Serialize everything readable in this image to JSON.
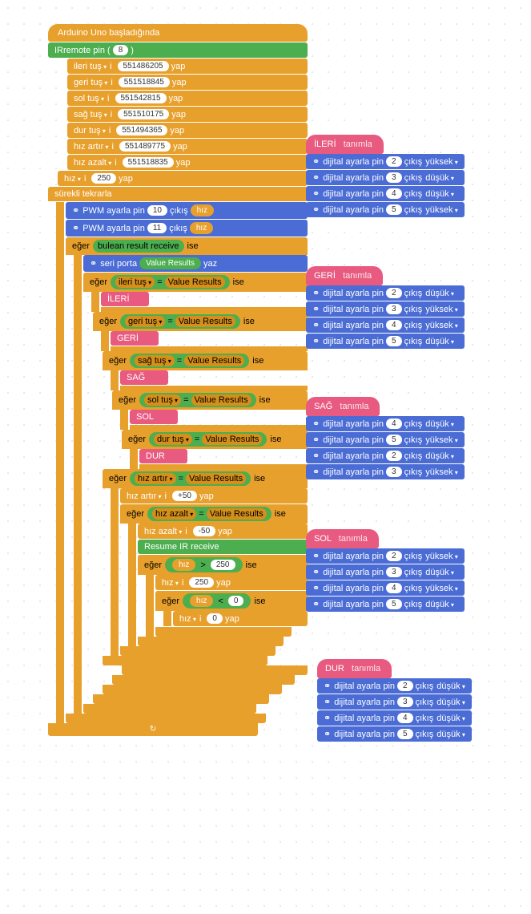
{
  "event": {
    "label": "Arduino Uno başladığında"
  },
  "irremote": {
    "label": "IRremote pin (",
    "pin": "8",
    "close": ")"
  },
  "setvars": [
    {
      "name": "ileri tuş",
      "i": "i",
      "val": "551486205",
      "yap": "yap"
    },
    {
      "name": "geri tuş",
      "i": "i",
      "val": "551518845",
      "yap": "yap"
    },
    {
      "name": "sol tuş",
      "i": "i",
      "val": "551542815",
      "yap": "yap"
    },
    {
      "name": "sağ tuş",
      "i": "i",
      "val": "551510175",
      "yap": "yap"
    },
    {
      "name": "dur tuş",
      "i": "i",
      "val": "551494365",
      "yap": "yap"
    },
    {
      "name": "hız artır",
      "i": "i",
      "val": "551489775",
      "yap": "yap"
    },
    {
      "name": "hız azalt",
      "i": "i",
      "val": "551518835",
      "yap": "yap"
    },
    {
      "name": "hız",
      "i": "i",
      "val": "250",
      "yap": "yap"
    }
  ],
  "forever": "sürekli tekrarla",
  "pwm": [
    {
      "label": "PWM ayarla pin",
      "pin": "10",
      "out": "çıkış",
      "var": "hız"
    },
    {
      "label": "PWM ayarla pin",
      "pin": "11",
      "out": "çıkış",
      "var": "hız"
    }
  ],
  "if_label": "eğer",
  "ise_label": "ise",
  "bulean": "bulean result receive",
  "serial": {
    "label": "seri porta",
    "var": "Value Results",
    "yaz": "yaz"
  },
  "checks": [
    {
      "var": "ileri tuş",
      "eq": "=",
      "vr": "Value Results",
      "call": "İLERİ"
    },
    {
      "var": "geri tuş",
      "eq": "=",
      "vr": "Value Results",
      "call": "GERİ"
    },
    {
      "var": "sağ tuş",
      "eq": "=",
      "vr": "Value Results",
      "call": "SAĞ"
    },
    {
      "var": "sol tuş",
      "eq": "=",
      "vr": "Value Results",
      "call": "SOL"
    },
    {
      "var": "dur tuş",
      "eq": "=",
      "vr": "Value Results",
      "call": "DUR"
    }
  ],
  "hizartir": {
    "var": "hız artır",
    "eq": "=",
    "vr": "Value Results",
    "set": "hız artır",
    "i": "i",
    "val": "+50",
    "yap": "yap"
  },
  "hizazalt": {
    "var": "hız azalt",
    "eq": "=",
    "vr": "Value Results",
    "set": "hız azalt",
    "i": "i",
    "val": "-50",
    "yap": "yap"
  },
  "resume": "Resume IR receive",
  "limit_hi": {
    "var": "hız",
    "op": ">",
    "val": "250",
    "set": "hız",
    "i": "i",
    "sval": "250",
    "yap": "yap"
  },
  "limit_lo": {
    "var": "hız",
    "op": "<",
    "val": "0",
    "set": "hız",
    "i": "i",
    "sval": "0",
    "yap": "yap"
  },
  "defs": {
    "tanimla": "tanımla",
    "ILERI": {
      "name": "İLERİ",
      "pins": [
        {
          "lbl": "dijital ayarla pin",
          "pin": "2",
          "out": "çıkış",
          "lvl": "yüksek"
        },
        {
          "lbl": "dijital ayarla pin",
          "pin": "3",
          "out": "çıkış",
          "lvl": "düşük"
        },
        {
          "lbl": "dijital ayarla pin",
          "pin": "4",
          "out": "çıkış",
          "lvl": "düşük"
        },
        {
          "lbl": "dijital ayarla pin",
          "pin": "5",
          "out": "çıkış",
          "lvl": "yüksek"
        }
      ]
    },
    "GERI": {
      "name": "GERİ",
      "pins": [
        {
          "lbl": "dijital ayarla pin",
          "pin": "2",
          "out": "çıkış",
          "lvl": "düşük"
        },
        {
          "lbl": "dijital ayarla pin",
          "pin": "3",
          "out": "çıkış",
          "lvl": "yüksek"
        },
        {
          "lbl": "dijital ayarla pin",
          "pin": "4",
          "out": "çıkış",
          "lvl": "yüksek"
        },
        {
          "lbl": "dijital ayarla pin",
          "pin": "5",
          "out": "çıkış",
          "lvl": "düşük"
        }
      ]
    },
    "SAG": {
      "name": "SAĞ",
      "pins": [
        {
          "lbl": "dijital ayarla pin",
          "pin": "4",
          "out": "çıkış",
          "lvl": "düşük"
        },
        {
          "lbl": "dijital ayarla pin",
          "pin": "5",
          "out": "çıkış",
          "lvl": "yüksek"
        },
        {
          "lbl": "dijital ayarla pin",
          "pin": "2",
          "out": "çıkış",
          "lvl": "düşük"
        },
        {
          "lbl": "dijital ayarla pin",
          "pin": "3",
          "out": "çıkış",
          "lvl": "yüksek"
        }
      ]
    },
    "SOL": {
      "name": "SOL",
      "pins": [
        {
          "lbl": "dijital ayarla pin",
          "pin": "2",
          "out": "çıkış",
          "lvl": "yüksek"
        },
        {
          "lbl": "dijital ayarla pin",
          "pin": "3",
          "out": "çıkış",
          "lvl": "düşük"
        },
        {
          "lbl": "dijital ayarla pin",
          "pin": "4",
          "out": "çıkış",
          "lvl": "yüksek"
        },
        {
          "lbl": "dijital ayarla pin",
          "pin": "5",
          "out": "çıkış",
          "lvl": "düşük"
        }
      ]
    },
    "DUR": {
      "name": "DUR",
      "pins": [
        {
          "lbl": "dijital ayarla pin",
          "pin": "2",
          "out": "çıkış",
          "lvl": "düşük"
        },
        {
          "lbl": "dijital ayarla pin",
          "pin": "3",
          "out": "çıkış",
          "lvl": "düşük"
        },
        {
          "lbl": "dijital ayarla pin",
          "pin": "4",
          "out": "çıkış",
          "lvl": "düşük"
        },
        {
          "lbl": "dijital ayarla pin",
          "pin": "5",
          "out": "çıkış",
          "lvl": "düşük"
        }
      ]
    }
  },
  "glyph": "⚭"
}
